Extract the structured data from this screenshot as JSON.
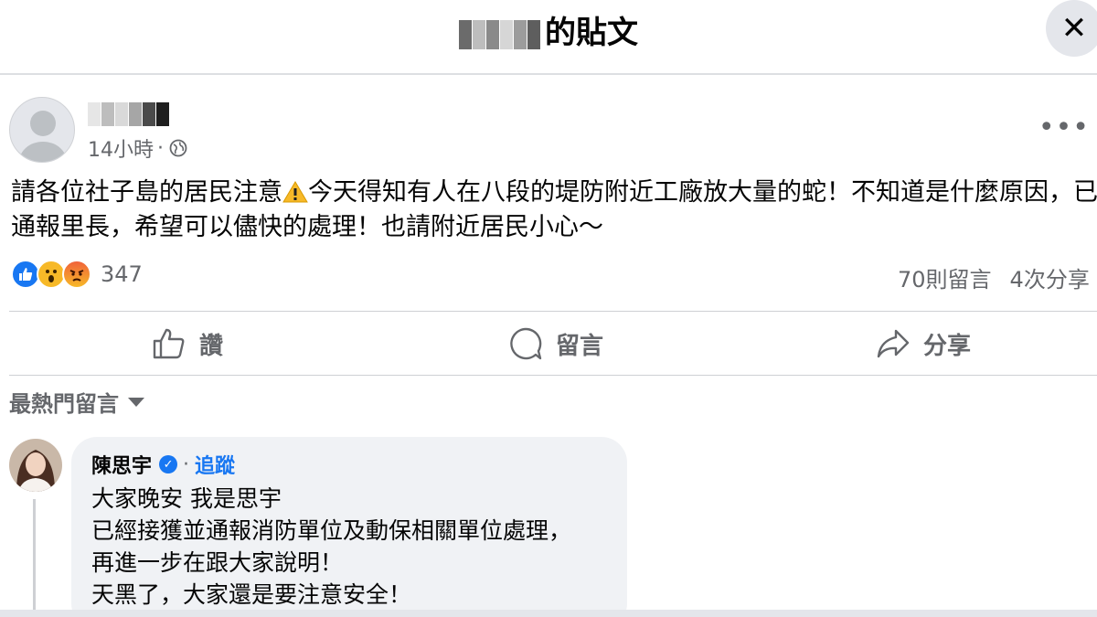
{
  "header": {
    "title_suffix": "的貼文",
    "close_label": "✕"
  },
  "post": {
    "timestamp": "14小時",
    "separator": "·",
    "more_label": "•••",
    "text_line1_a": "請各位社子島的居民注意",
    "text_line1_b": "今天得知有人在八段的堤防附近工廠放大量的蛇！不知道是什麼原因，已",
    "text_line2": "通報里長，希望可以儘快的處理！也請附近居民小心～",
    "reaction_count": "347",
    "comment_count": "70則留言",
    "share_count": "4次分享"
  },
  "actions": {
    "like": "讚",
    "comment": "留言",
    "share": "分享"
  },
  "comments_section": {
    "sort_label": "最熱門留言"
  },
  "comment": {
    "author": "陳思宇",
    "separator": "·",
    "follow": "追蹤",
    "lines": [
      "大家晚安 我是思宇",
      "已經接獲並通報消防單位及動保相關單位處理，",
      "再進一步在跟大家說明！",
      "天黑了，大家還是要注意安全！"
    ]
  },
  "colors": {
    "accent": "#1877f2",
    "secondary_text": "#65676b",
    "bubble_bg": "#f0f2f5"
  }
}
